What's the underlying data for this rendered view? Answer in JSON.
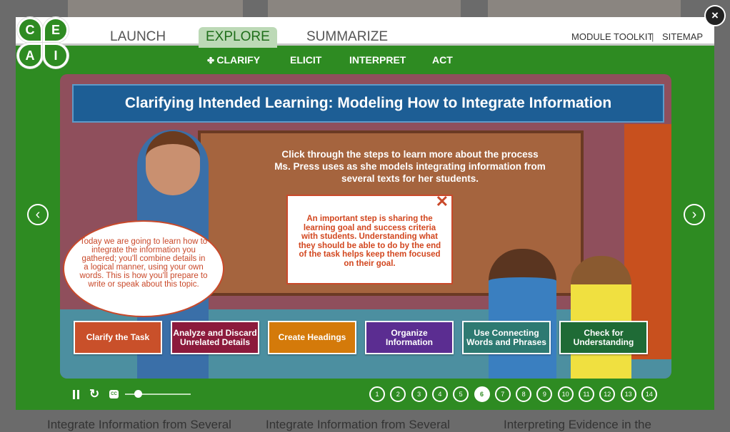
{
  "background": {
    "captions": [
      "Integrate Information from Several",
      "Integrate Information from Several",
      "Interpreting Evidence in the"
    ]
  },
  "logo": {
    "letters": [
      "C",
      "E",
      "A",
      "I"
    ]
  },
  "nav": {
    "tabs": [
      {
        "label": "LAUNCH"
      },
      {
        "label": "EXPLORE",
        "active": true
      },
      {
        "label": "SUMMARIZE"
      }
    ],
    "links": {
      "toolkit": "MODULE TOOLKIT",
      "separator": "|",
      "sitemap": "SITEMAP"
    },
    "subtabs": [
      {
        "label": "CLARIFY",
        "active": true
      },
      {
        "label": "ELICIT"
      },
      {
        "label": "INTERPRET"
      },
      {
        "label": "ACT"
      }
    ]
  },
  "close_label": "×",
  "slide": {
    "title": "Clarifying Intended Learning: Modeling How to Integrate Information",
    "intro": "Click through the steps to learn more about the process Ms. Press uses as she models integrating information from several texts for her students.",
    "popup": {
      "close": "✕",
      "text": "An important step is sharing the learning goal and success criteria with students. Understanding what they should be able to do by the end of the task helps keep them focused on their goal."
    },
    "speech": "Today we are going to learn how to integrate the information you gathered; you'll combine details in a logical manner, using your own words. This is how you'll prepare to write or speak about this topic.",
    "steps": [
      {
        "label": "Clarify the Task",
        "color": "#c9502a"
      },
      {
        "label": "Analyze and Discard Unrelated Details",
        "color": "#8c1a3c"
      },
      {
        "label": "Create Headings",
        "color": "#d47a0a"
      },
      {
        "label": "Organize Information",
        "color": "#5b2d91"
      },
      {
        "label": "Use Connecting Words and Phrases",
        "color": "#2e7a72"
      },
      {
        "label": "Check for Understanding",
        "color": "#1f6b36"
      }
    ]
  },
  "arrows": {
    "prev": "‹",
    "next": "›"
  },
  "controls": {
    "cc": "CC",
    "volume": 0.2
  },
  "pages": [
    "1",
    "2",
    "3",
    "4",
    "5",
    "6",
    "7",
    "8",
    "9",
    "10",
    "11",
    "12",
    "13",
    "14"
  ],
  "current_page": "6",
  "colors": {
    "green": "#2e8b22",
    "title_blue": "#1d5e95"
  }
}
